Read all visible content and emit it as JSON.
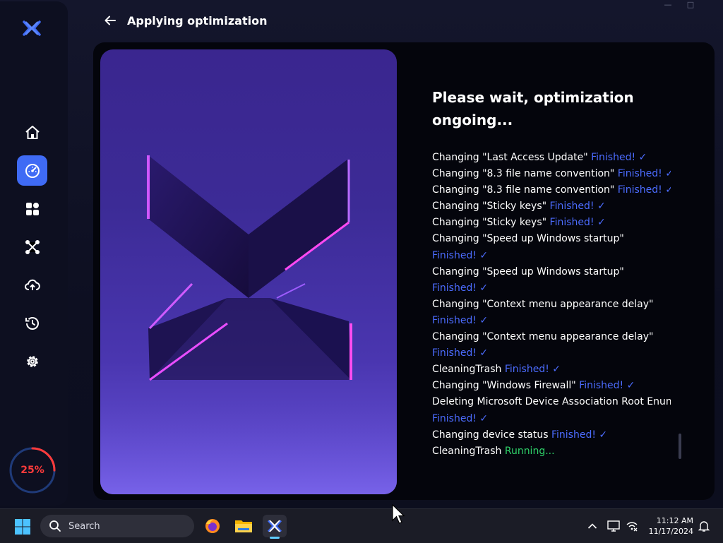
{
  "window": {
    "controls": [
      "minimize",
      "maximize",
      "close"
    ]
  },
  "header": {
    "title": "Applying optimization",
    "back_icon": "arrow-left-icon"
  },
  "sidebar": {
    "logo_icon": "app-x-logo-icon",
    "items": [
      {
        "icon": "home-icon",
        "active": false
      },
      {
        "icon": "speedometer-icon",
        "active": true
      },
      {
        "icon": "apps-grid-icon",
        "active": false
      },
      {
        "icon": "network-nodes-icon",
        "active": false
      },
      {
        "icon": "cloud-upload-icon",
        "active": false
      },
      {
        "icon": "history-icon",
        "active": false
      },
      {
        "icon": "gear-icon",
        "active": false
      }
    ],
    "progress": {
      "label": "25%",
      "value": 0.25,
      "color": "#ff3b3b"
    }
  },
  "main": {
    "status_title": "Please wait, optimization ongoing...",
    "log": [
      {
        "text": "Changing \"Last Access Update\"",
        "status": "Finished!",
        "state": "done",
        "wrap": false
      },
      {
        "text": "Changing \"8.3 file name convention\"",
        "status": "Finished!",
        "state": "done",
        "wrap": false
      },
      {
        "text": "Changing \"8.3 file name convention\"",
        "status": "Finished!",
        "state": "done",
        "wrap": false
      },
      {
        "text": "Changing \"Sticky keys\"",
        "status": "Finished!",
        "state": "done",
        "wrap": false
      },
      {
        "text": "Changing \"Sticky keys\"",
        "status": "Finished!",
        "state": "done",
        "wrap": false
      },
      {
        "text": "Changing \"Speed up Windows startup\"",
        "status": "Finished!",
        "state": "done",
        "wrap": true
      },
      {
        "text": "Changing \"Speed up Windows startup\"",
        "status": "Finished!",
        "state": "done",
        "wrap": true
      },
      {
        "text": "Changing \"Context menu appearance delay\"",
        "status": "Finished!",
        "state": "done",
        "wrap": true
      },
      {
        "text": "Changing \"Context menu appearance delay\"",
        "status": "Finished!",
        "state": "done",
        "wrap": true
      },
      {
        "text": "CleaningTrash",
        "status": "Finished!",
        "state": "done",
        "wrap": false
      },
      {
        "text": "Changing \"Windows Firewall\"",
        "status": "Finished!",
        "state": "done",
        "wrap": false
      },
      {
        "text": "Deleting Microsoft Device Association Root Enume",
        "status": "Finished!",
        "state": "done",
        "wrap": true
      },
      {
        "text": "Changing device status",
        "status": "Finished!",
        "state": "done",
        "wrap": false
      },
      {
        "text": "CleaningTrash",
        "status": "Running...",
        "state": "running",
        "wrap": false
      }
    ],
    "colors": {
      "finished": "#4c6cff",
      "running": "#2fd36a"
    }
  },
  "taskbar": {
    "search_placeholder": "Search",
    "apps": [
      {
        "icon": "firefox-icon",
        "active": false
      },
      {
        "icon": "file-explorer-icon",
        "active": false
      },
      {
        "icon": "app-x-logo-icon",
        "active": true
      }
    ],
    "tray": [
      "chevron-up-icon",
      "display-icon",
      "network-icon",
      "notification-bell-icon"
    ],
    "time": "11:12 AM",
    "date": "11/17/2024"
  }
}
